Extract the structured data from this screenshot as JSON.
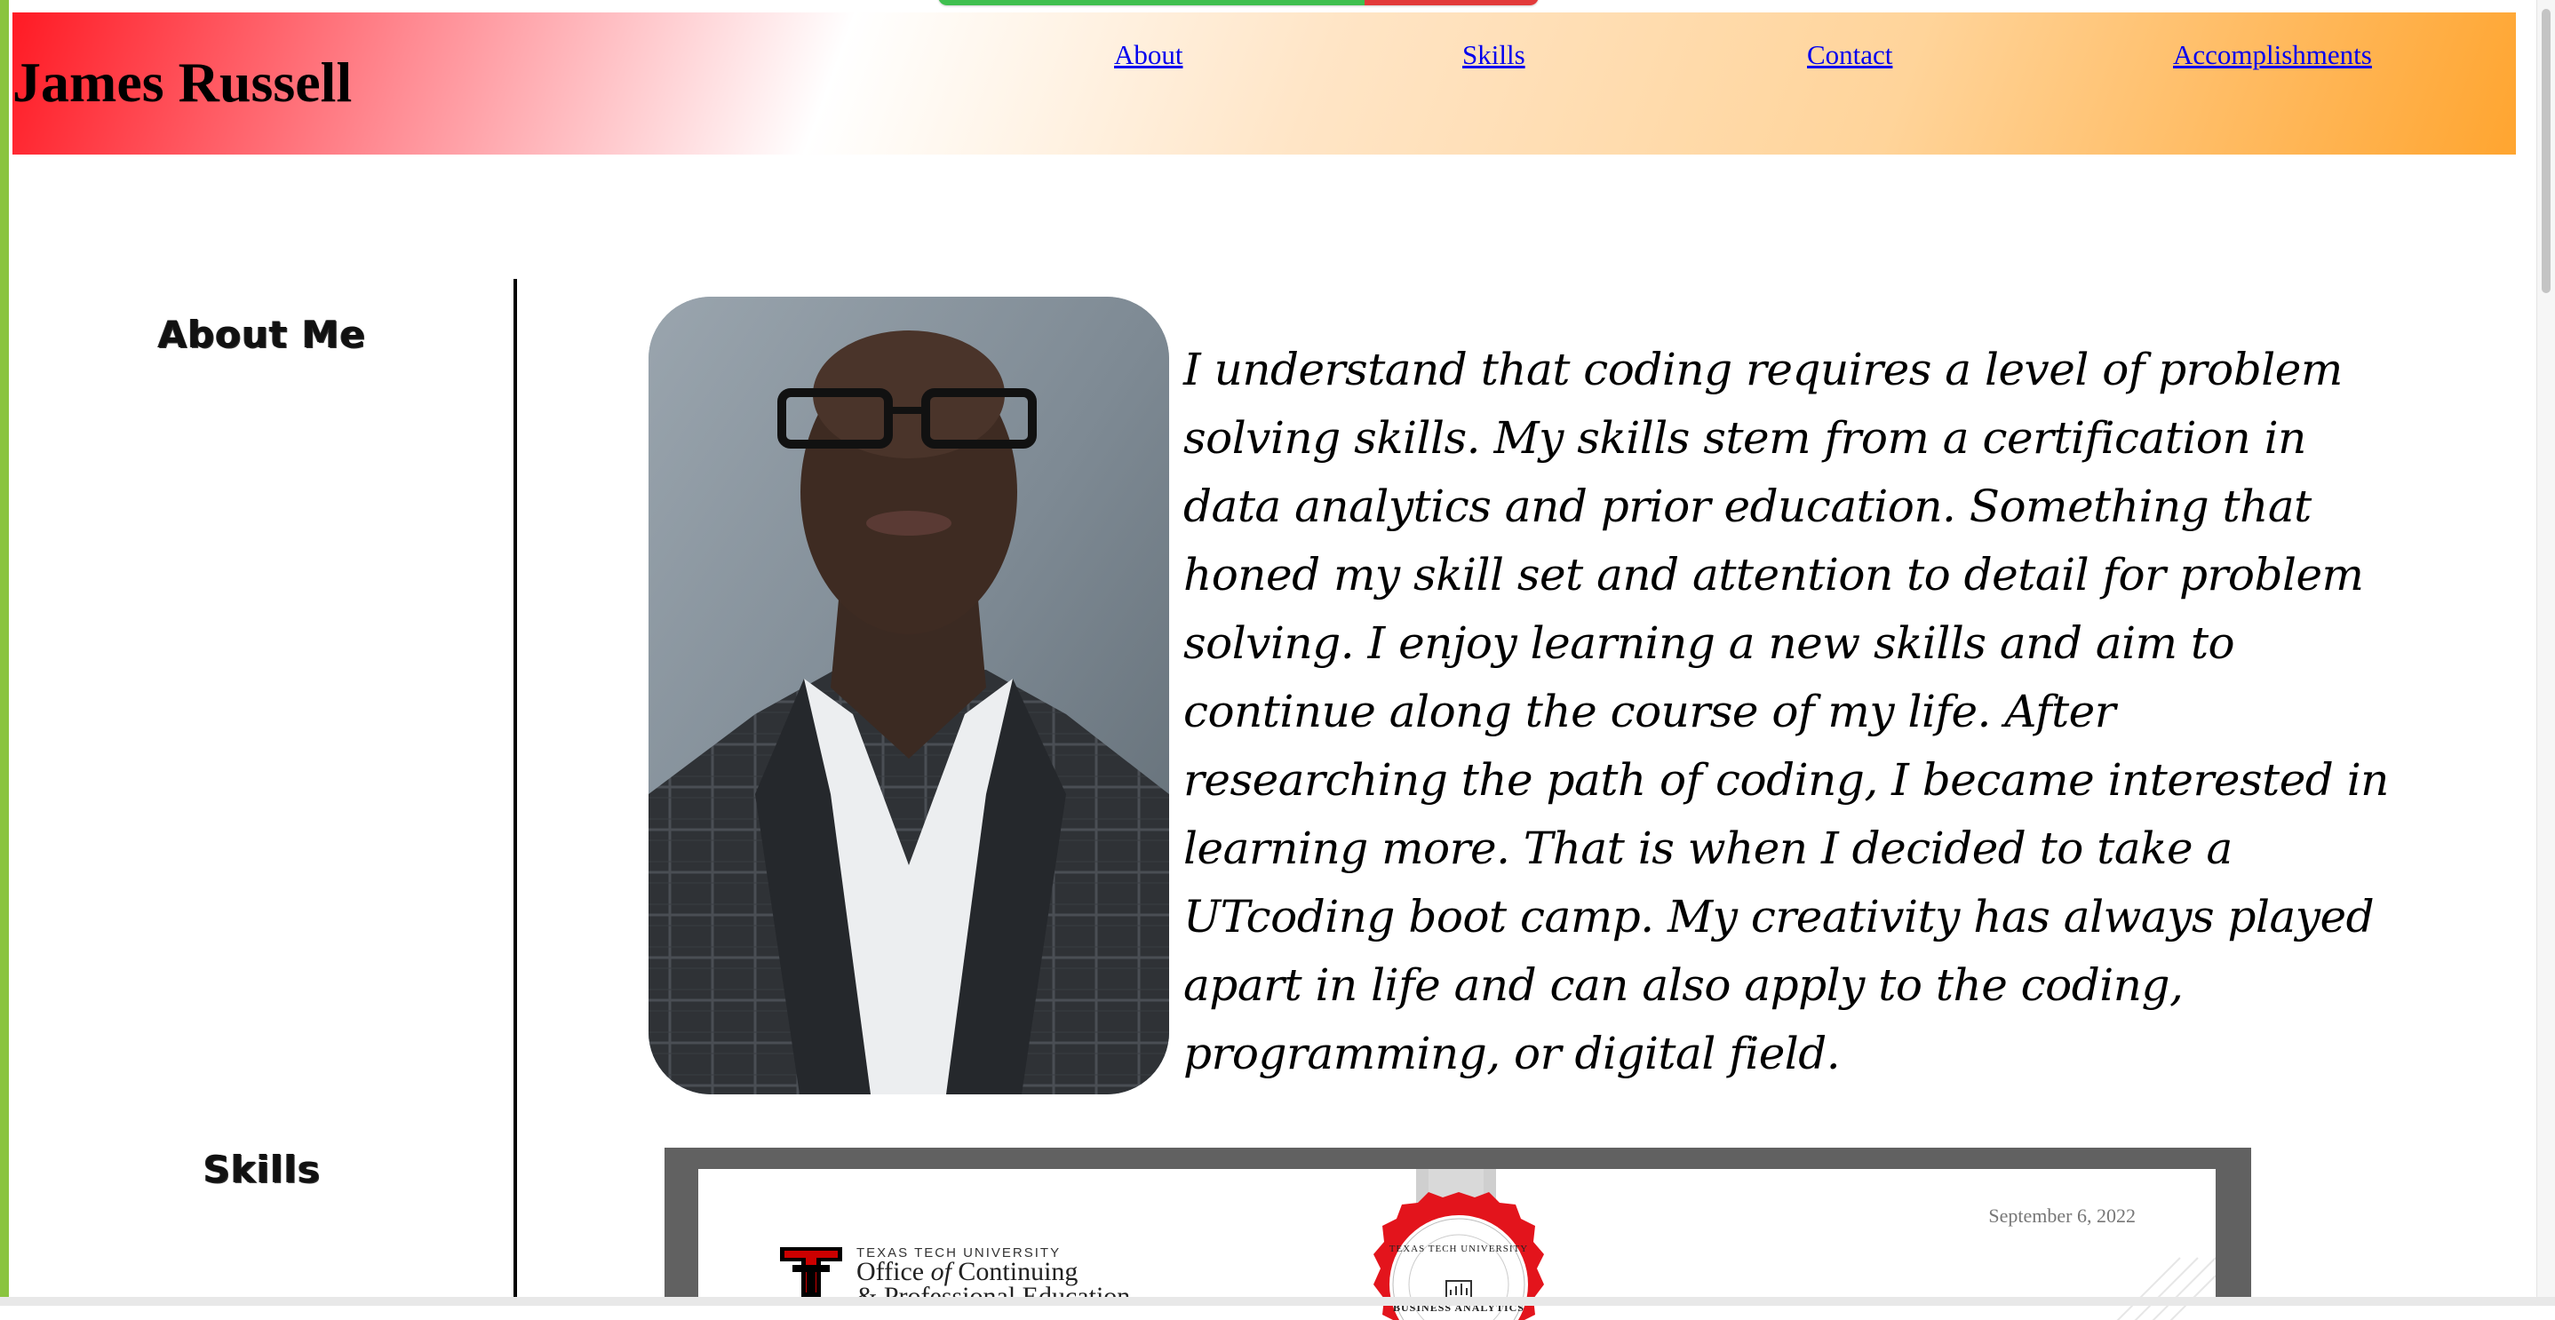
{
  "header": {
    "title": "James Russell",
    "nav": [
      {
        "label": "About"
      },
      {
        "label": "Skills"
      },
      {
        "label": "Contact"
      },
      {
        "label": "Accomplishments"
      }
    ],
    "gradient_colors": [
      "#ff1a24",
      "#ffffff",
      "#ffa530"
    ]
  },
  "sidebar": {
    "sections": [
      {
        "label": "About Me"
      },
      {
        "label": "Skills"
      }
    ]
  },
  "about": {
    "text": "I understand that coding requires a level of problem solving skills. My skills stem from a certification in data analytics and prior education. Something that honed my skill set and attention to detail for problem solving. I enjoy learning a new skills and aim to continue along the course of my life. After researching the path of coding, I became interested in learning more. That is when I decided to take a UTcoding boot camp. My creativity has always played apart in life and can also apply to the coding, programming, or digital field."
  },
  "certificate": {
    "date": "September 6, 2022",
    "university_small": "TEXAS TECH UNIVERSITY",
    "office_line1_a": "Office ",
    "office_line1_of": "of",
    "office_line1_b": " Continuing",
    "office_line2": "& Professional Education",
    "seal_university": "TEXAS TECH UNIVERSITY",
    "seal_program": "BUSINESS ANALYTICS"
  },
  "colors": {
    "window_frame": "#8ac43f",
    "divider": "#000000",
    "link": "#0000ee",
    "certificate_frame": "#616161",
    "seal_red": "#e3141c"
  }
}
